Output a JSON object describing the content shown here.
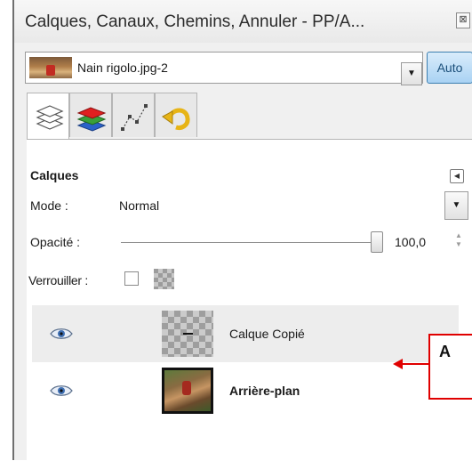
{
  "window": {
    "title": "Calques, Canaux, Chemins, Annuler - PP/A...",
    "close_glyph": "⊠"
  },
  "image_selector": {
    "name": "Nain rigolo.jpg-2",
    "auto_label": "Auto"
  },
  "tabs": [
    {
      "icon": "layers-icon",
      "active": true
    },
    {
      "icon": "channels-icon",
      "active": false
    },
    {
      "icon": "paths-icon",
      "active": false
    },
    {
      "icon": "undo-history-icon",
      "active": false
    }
  ],
  "panel": {
    "title": "Calques",
    "mode_label": "Mode :",
    "mode_value": "Normal",
    "opacity_label": "Opacité :",
    "opacity_value": "100,0",
    "lock_label": "Verrouiller :"
  },
  "layers": [
    {
      "name": "Calque Copié",
      "visible": true,
      "selected": true,
      "thumbnail": "transparent-with-dash"
    },
    {
      "name": "Arrière-plan",
      "visible": true,
      "selected": false,
      "thumbnail": "photo"
    }
  ],
  "annotation": {
    "text": "A",
    "color": "#e00000"
  },
  "colors": {
    "accent": "#a9d2f3",
    "callout": "#e00000"
  }
}
